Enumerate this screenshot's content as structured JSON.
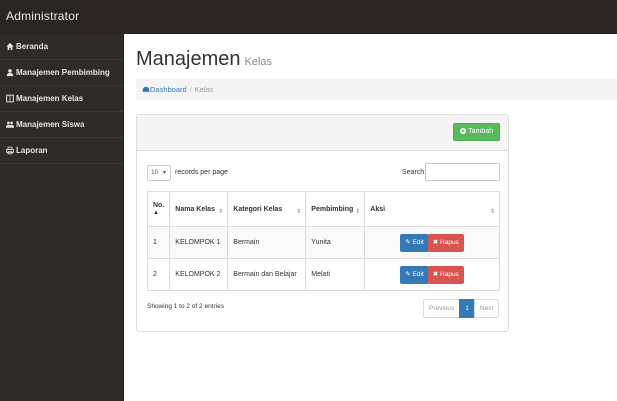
{
  "app": {
    "title": "Administrator"
  },
  "sidebar": {
    "items": [
      {
        "label": "Beranda",
        "icon": "home-icon"
      },
      {
        "label": "Manajemen Pembimbing",
        "icon": "user-icon"
      },
      {
        "label": "Manajemen Kelas",
        "icon": "columns-icon"
      },
      {
        "label": "Manajemen Siswa",
        "icon": "users-icon"
      },
      {
        "label": "Laporan",
        "icon": "print-icon"
      }
    ]
  },
  "page": {
    "title": "Manajemen",
    "subtitle": "Kelas",
    "breadcrumb": {
      "home": "Dashboard",
      "separator": "/",
      "current": "Kelas"
    }
  },
  "panel": {
    "add_button": "Tambah"
  },
  "table_controls": {
    "length_value": "10",
    "length_text": "records per page",
    "search_label": "Search:",
    "search_value": ""
  },
  "table": {
    "headers": [
      "No.",
      "Nama Kelas",
      "Kategori Kelas",
      "Pembimbing",
      "Aksi"
    ],
    "rows": [
      {
        "no": "1",
        "nama": "KELOMPOK 1",
        "kategori": "Bermain",
        "pembimbing": "Yunita"
      },
      {
        "no": "2",
        "nama": "KELOMPOK 2",
        "kategori": "Bermain dan Belajar",
        "pembimbing": "Melati"
      }
    ],
    "edit_label": "Edit",
    "delete_label": "Hapus"
  },
  "footer": {
    "info": "Showing 1 to 2 of 2 entries",
    "prev": "Previous",
    "page": "1",
    "next": "Next"
  },
  "colors": {
    "topbar": "#2b2623",
    "sidebar": "#2f2b28",
    "primary": "#337ab7",
    "success": "#5cb85c",
    "danger": "#d9534f"
  }
}
